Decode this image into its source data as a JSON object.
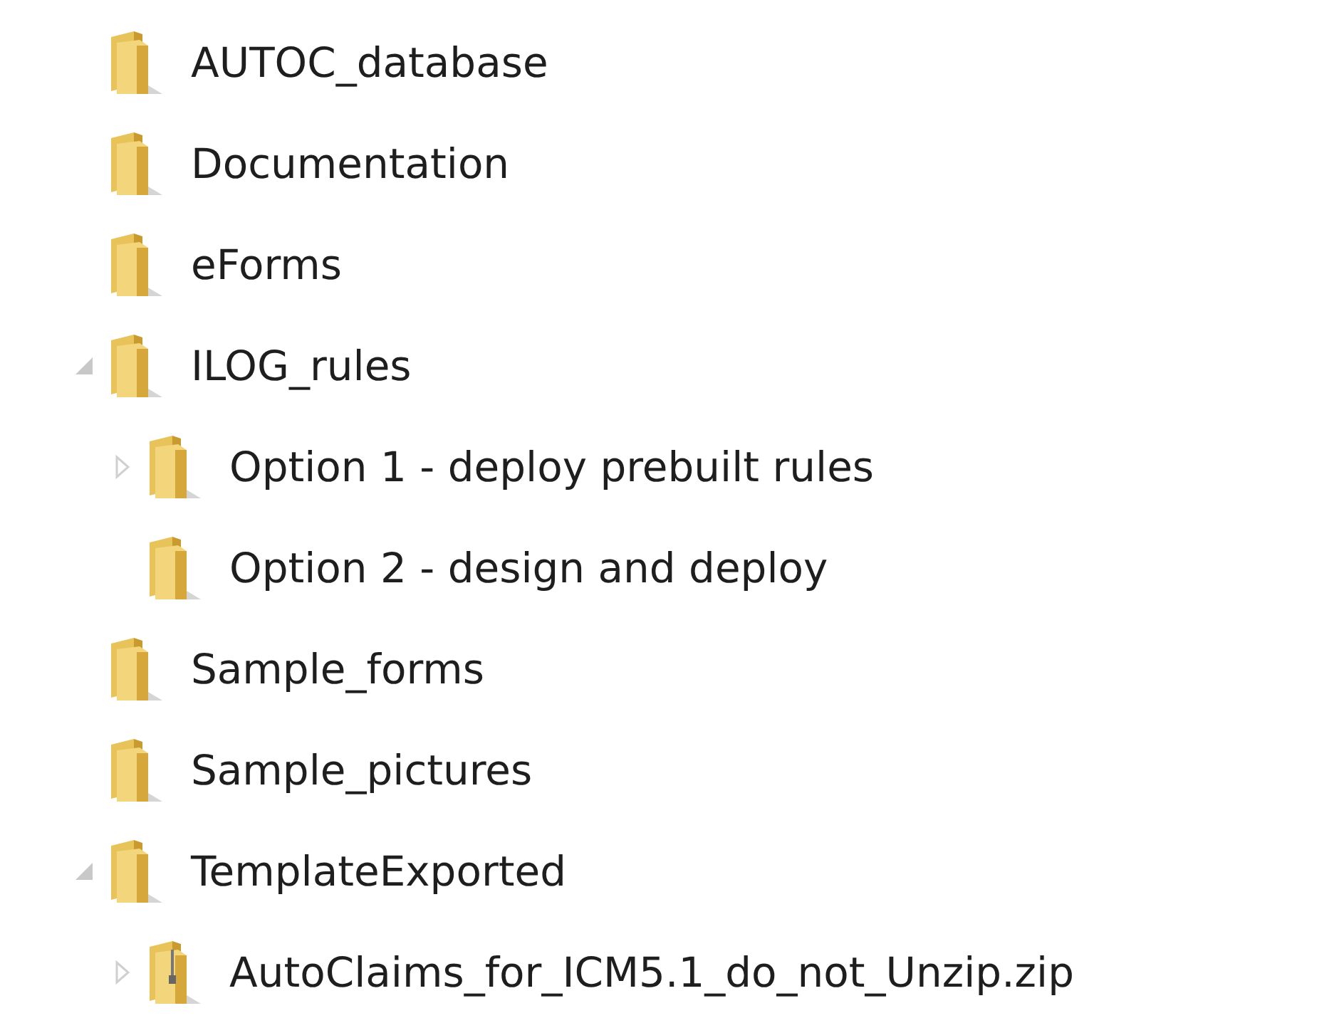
{
  "tree": [
    {
      "label": "AUTOC_database",
      "kind": "folder"
    },
    {
      "label": "Documentation",
      "kind": "folder"
    },
    {
      "label": "eForms",
      "kind": "folder"
    },
    {
      "label": "ILOG_rules",
      "kind": "folder",
      "expanded": true,
      "children": [
        {
          "label": "Option 1 - deploy prebuilt rules",
          "kind": "folder",
          "expanded": false
        },
        {
          "label": "Option 2 - design and deploy",
          "kind": "folder"
        }
      ]
    },
    {
      "label": "Sample_forms",
      "kind": "folder"
    },
    {
      "label": "Sample_pictures",
      "kind": "folder"
    },
    {
      "label": "TemplateExported",
      "kind": "folder",
      "expanded": true,
      "children": [
        {
          "label": "AutoClaims_for_ICM5.1_do_not_Unzip.zip",
          "kind": "zip",
          "expanded": false
        }
      ]
    }
  ]
}
